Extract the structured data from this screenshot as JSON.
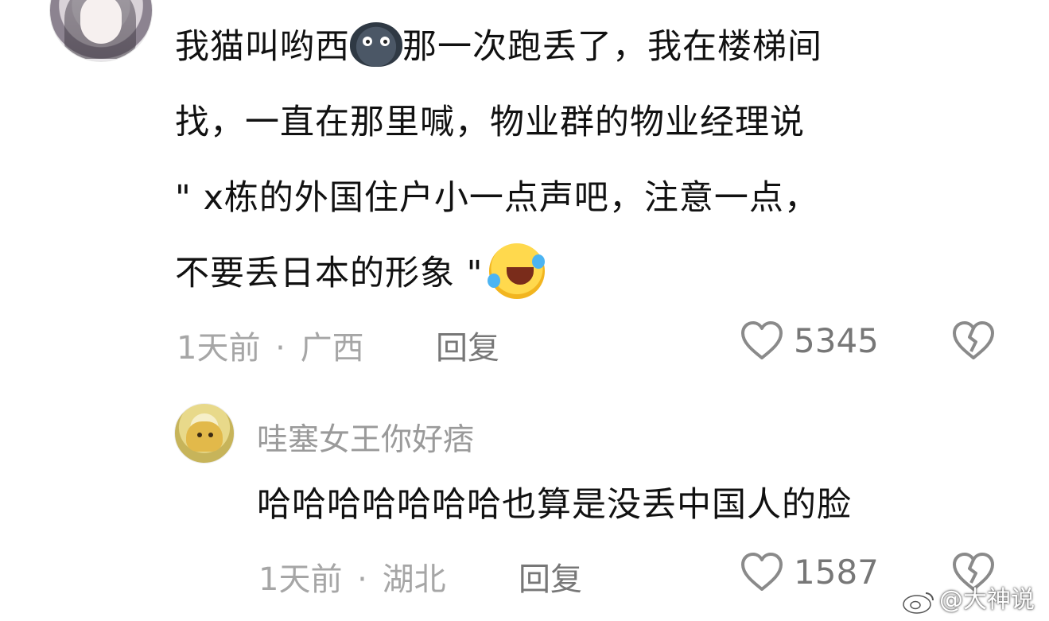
{
  "comment": {
    "lines": [
      "我猫叫哟西",
      "那一次跑丢了，我在楼梯间",
      "找，一直在那里喊，物业群的物业经理说",
      "\" x栋的外国住户小一点声吧，注意一点，",
      "不要丢日本的形象 \""
    ],
    "emoji_inline": "sad-face-emoji",
    "emoji_end": "laughing-tears-emoji",
    "time": "1天前",
    "separator": "·",
    "location": "广西",
    "reply_label": "回复",
    "likes": "5345"
  },
  "reply": {
    "username": "哇塞女王你好痞",
    "text": "哈哈哈哈哈哈哈也算是没丢中国人的脸",
    "time": "1天前",
    "separator": "·",
    "location": "湖北",
    "reply_label": "回复",
    "likes": "1587"
  },
  "watermark": {
    "text": "@大神说"
  },
  "colors": {
    "text_primary": "#111111",
    "text_meta": "#a6a6a6",
    "text_action": "#777777",
    "background": "#ffffff"
  }
}
